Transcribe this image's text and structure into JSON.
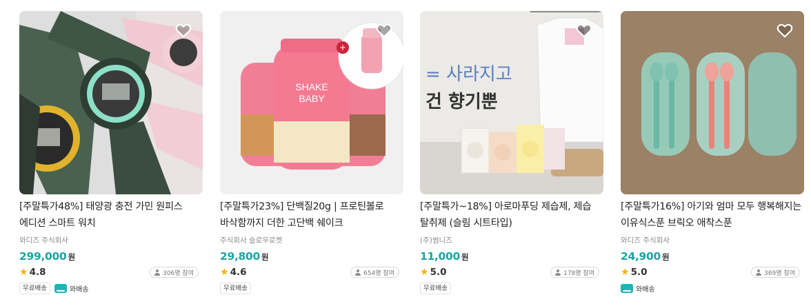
{
  "products": [
    {
      "title": "[주말특가48%] 태양광 충전 가민 원피스 에디션 스마트 워치",
      "seller": "와디즈 주식회사",
      "price": "299,000",
      "currency": "원",
      "rating": "4.8",
      "participants": "306명 참여",
      "badges": [
        "무료배송"
      ],
      "truck_label": "와배송",
      "colors": {
        "bg": "#dcdcdc"
      }
    },
    {
      "title": "[주말특가23%] 단백질20g | 프로틴볼로 바삭함까지 더한 고단백 쉐이크",
      "seller": "주식회사 슬로우로켓",
      "price": "29,800",
      "currency": "원",
      "rating": "4.6",
      "participants": "654명 참여",
      "badges": [
        "무료배송"
      ],
      "product_label": "SHAKE BABY",
      "colors": {
        "bg": "#efefef"
      }
    },
    {
      "title": "[주말특가~18%] 아로마푸딩 제습제, 제습 탈취제 (슬림 시트타입)",
      "seller": "(주)썸니즈",
      "price": "11,000",
      "currency": "원",
      "rating": "5.0",
      "participants": "178명 참여",
      "badges": [
        "무료배송"
      ],
      "image_text_1": "= 사라지고",
      "image_text_2": "건 향기뿐",
      "colors": {
        "bg": "#ecebe9"
      }
    },
    {
      "title": "[주말특가16%] 아기와 엄마 모두 행복해지는 이유식스푼 브릭오 애착스푼",
      "seller": "와디즈 주식회사",
      "price": "24,900",
      "currency": "원",
      "rating": "5.0",
      "participants": "369명 참여",
      "truck_label": "와배송",
      "colors": {
        "bg": "#9c8266"
      }
    }
  ],
  "colors": {
    "price": "#1aa5a5",
    "star": "#f5b301",
    "accent": "#22b4b4"
  },
  "icons": [
    "heart-icon",
    "star-icon",
    "person-icon",
    "truck-icon"
  ]
}
